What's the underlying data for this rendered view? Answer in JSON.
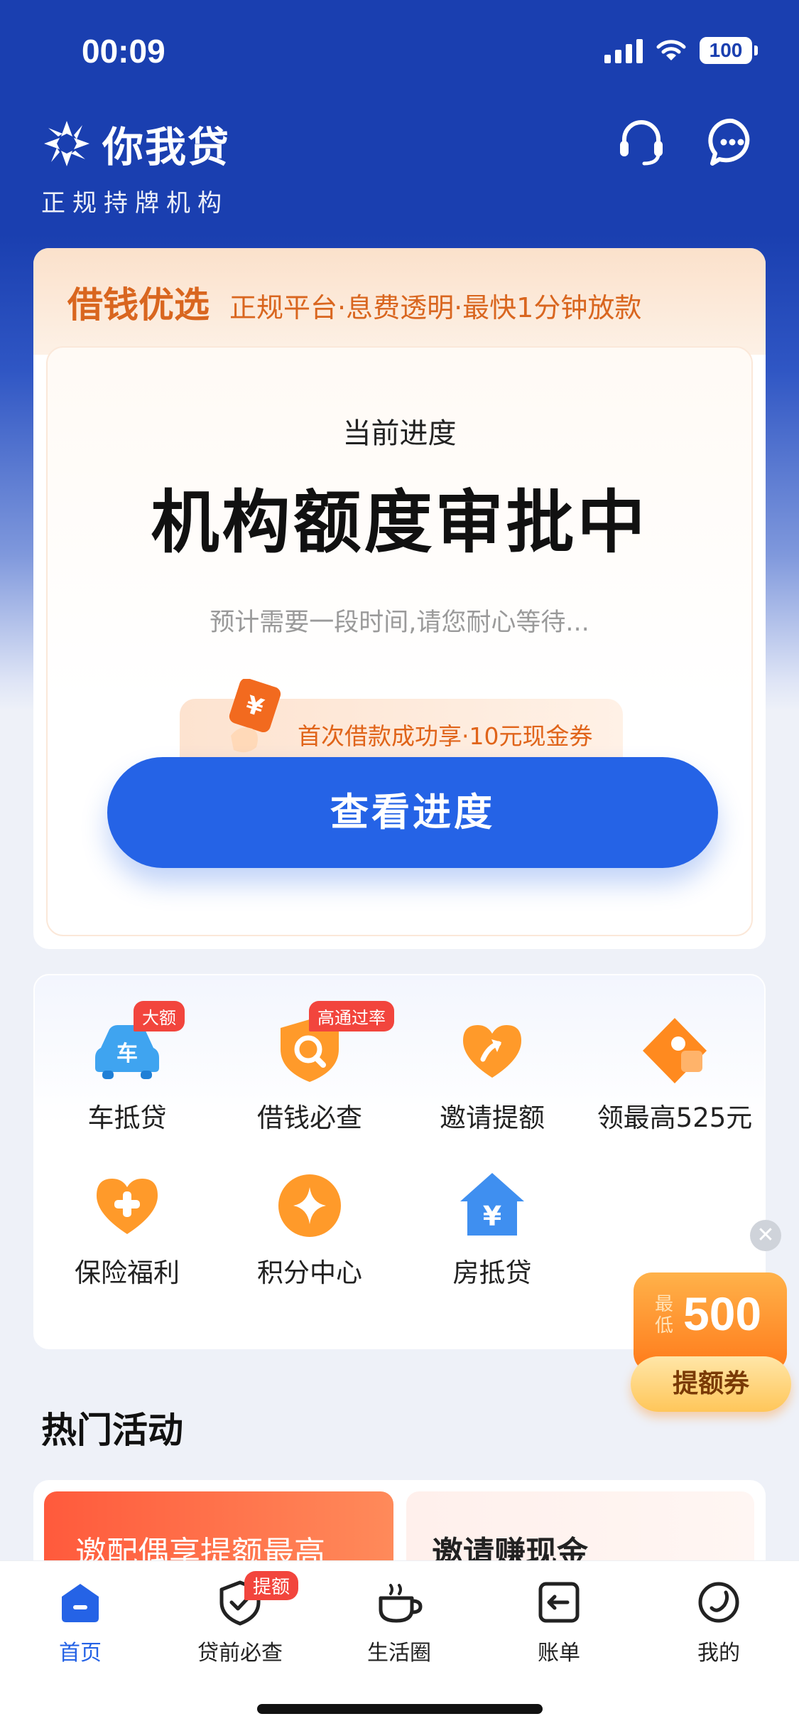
{
  "status_bar": {
    "time": "00:09",
    "battery": "100"
  },
  "header": {
    "brand_name": "你我贷",
    "brand_subtitle": "正规持牌机构"
  },
  "loan_card": {
    "title": "借钱优选",
    "slogan": "正规平台·息费透明·最快1分钟放款",
    "progress_label": "当前进度",
    "progress_status": "机构额度审批中",
    "progress_hint": "预计需要一段时间,请您耐心等待...",
    "coupon_text": "首次借款成功享·10元现金券",
    "view_button": "查看进度"
  },
  "services": [
    {
      "label": "车抵贷",
      "badge": "大额",
      "icon": "car-loan-icon"
    },
    {
      "label": "借钱必查",
      "badge": "高通过率",
      "icon": "search-shield-icon"
    },
    {
      "label": "邀请提额",
      "badge": "",
      "icon": "heart-arrow-icon"
    },
    {
      "label": "领最高525元",
      "badge": "",
      "icon": "coupon-tag-icon"
    },
    {
      "label": "保险福利",
      "badge": "",
      "icon": "heart-plus-icon"
    },
    {
      "label": "积分中心",
      "badge": "",
      "icon": "star-coin-icon"
    },
    {
      "label": "房抵贷",
      "badge": "",
      "icon": "house-yuan-icon"
    }
  ],
  "float_promo": {
    "min_label": "最低",
    "amount": "500",
    "button": "提额券"
  },
  "hot": {
    "title": "热门活动",
    "activities": [
      "邀配偶享提额最高",
      "邀请赚现金"
    ]
  },
  "tabs": [
    {
      "label": "首页",
      "badge": ""
    },
    {
      "label": "贷前必查",
      "badge": "提额"
    },
    {
      "label": "生活圈",
      "badge": ""
    },
    {
      "label": "账单",
      "badge": ""
    },
    {
      "label": "我的",
      "badge": ""
    }
  ],
  "colors": {
    "brand_blue": "#1a3fb0",
    "accent_blue": "#2563e6",
    "accent_orange": "#d9661f",
    "badge_red": "#f2453d"
  }
}
